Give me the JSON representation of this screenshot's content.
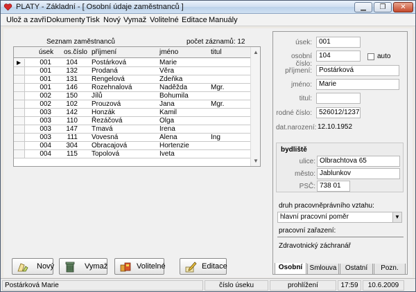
{
  "window": {
    "title": "PLATY  - Základní - [ Osobní údaje zaměstnanců ]",
    "icons": [
      "app-heart-icon",
      "minimize-icon",
      "restore-icon",
      "close-icon"
    ]
  },
  "menu": [
    "Ulož a zavři",
    "Dokumenty",
    "Tisk",
    "Nový",
    "Vymaž",
    "Volitelné",
    "Editace",
    "Manuály"
  ],
  "grid": {
    "caption": "Seznam zaměstnanců",
    "count_label": "počet záznamů: 12",
    "columns": [
      "úsek",
      "os.číslo",
      "příjmení",
      "jméno",
      "titul"
    ],
    "rows": [
      [
        "001",
        "104",
        "Postárková",
        "Marie",
        ""
      ],
      [
        "001",
        "132",
        "Prodaná",
        "Věra",
        ""
      ],
      [
        "001",
        "131",
        "Rengelová",
        "Zdeňka",
        ""
      ],
      [
        "001",
        "146",
        "Rozehnalová",
        "Naděžda",
        "Mgr."
      ],
      [
        "002",
        "150",
        "Jílů",
        "Bohumila",
        ""
      ],
      [
        "002",
        "102",
        "Prouzová",
        "Jana",
        "Mgr."
      ],
      [
        "003",
        "142",
        "Honzák",
        "Kamil",
        ""
      ],
      [
        "003",
        "110",
        "Řezáčová",
        "Olga",
        ""
      ],
      [
        "003",
        "147",
        "Tmavá",
        "Irena",
        ""
      ],
      [
        "003",
        "111",
        "Vovesná",
        "Alena",
        "Ing"
      ],
      [
        "004",
        "304",
        "Obracajová",
        "Hortenzie",
        ""
      ],
      [
        "004",
        "115",
        "Topolová",
        "Iveta",
        ""
      ]
    ],
    "selected_row": 0
  },
  "buttons": {
    "new": "Nový",
    "delete": "Vymaž",
    "optional": "Volitelné",
    "edit": "Editace"
  },
  "detail": {
    "usek_label": "úsek:",
    "usek": "001",
    "os_cislo_label": "osobní číslo:",
    "os_cislo": "104",
    "auto_label": "auto",
    "prijmeni_label": "příjmení:",
    "prijmeni": "Postárková",
    "jmeno_label": "jméno:",
    "jmeno": "Marie",
    "titul_label": "titul:",
    "titul": "",
    "rodne_cislo_label": "rodné číslo:",
    "rodne_cislo": "526012/1237",
    "dat_narozeni_label": "dat.narození:",
    "dat_narozeni": "12.10.1952",
    "bydliste_label": "bydliště",
    "ulice_label": "ulice:",
    "ulice": "Olbrachtova 65",
    "mesto_label": "město:",
    "mesto": "Jablunkov",
    "psc_label": "PSČ:",
    "psc": "738 01",
    "druh_label": "druh pracovněprávního vztahu:",
    "druh": "hlavní pracovní poměr",
    "zarazeni_label": "pracovní zařazení:",
    "zarazeni": "Zdravotnický záchranář"
  },
  "tabs": [
    "Osobní",
    "Smlouva",
    "Ostatní",
    "Pozn."
  ],
  "status": {
    "name": "Postárková Marie",
    "field": "číslo úseku",
    "mode": "prohlížení",
    "time": "17:59",
    "date": "10.6.2009"
  }
}
